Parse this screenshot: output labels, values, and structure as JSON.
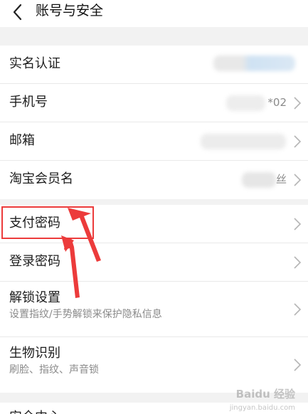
{
  "header": {
    "title": "账号与安全"
  },
  "group1": {
    "rows": [
      {
        "label": "实名认证",
        "value": ""
      },
      {
        "label": "手机号",
        "value": "*02"
      },
      {
        "label": "邮箱",
        "value": ""
      },
      {
        "label": "淘宝会员名",
        "value": "丝"
      }
    ]
  },
  "group2": {
    "rows": [
      {
        "label": "支付密码"
      },
      {
        "label": "登录密码"
      },
      {
        "label": "解锁设置",
        "sub": "设置指纹/手势解锁来保护隐私信息"
      },
      {
        "label": "生物识别",
        "sub": "刷脸、指纹、声音锁"
      }
    ]
  },
  "next_section": {
    "label": "安全中心"
  },
  "watermark": {
    "brand": "Baidu 经验",
    "url": "jingyan.baidu.com"
  },
  "colors": {
    "highlight": "#ec3b3b",
    "chevron": "#b5b5b5"
  },
  "icons": {
    "back": "chevron-left-icon",
    "row_arrow": "chevron-right-icon"
  }
}
